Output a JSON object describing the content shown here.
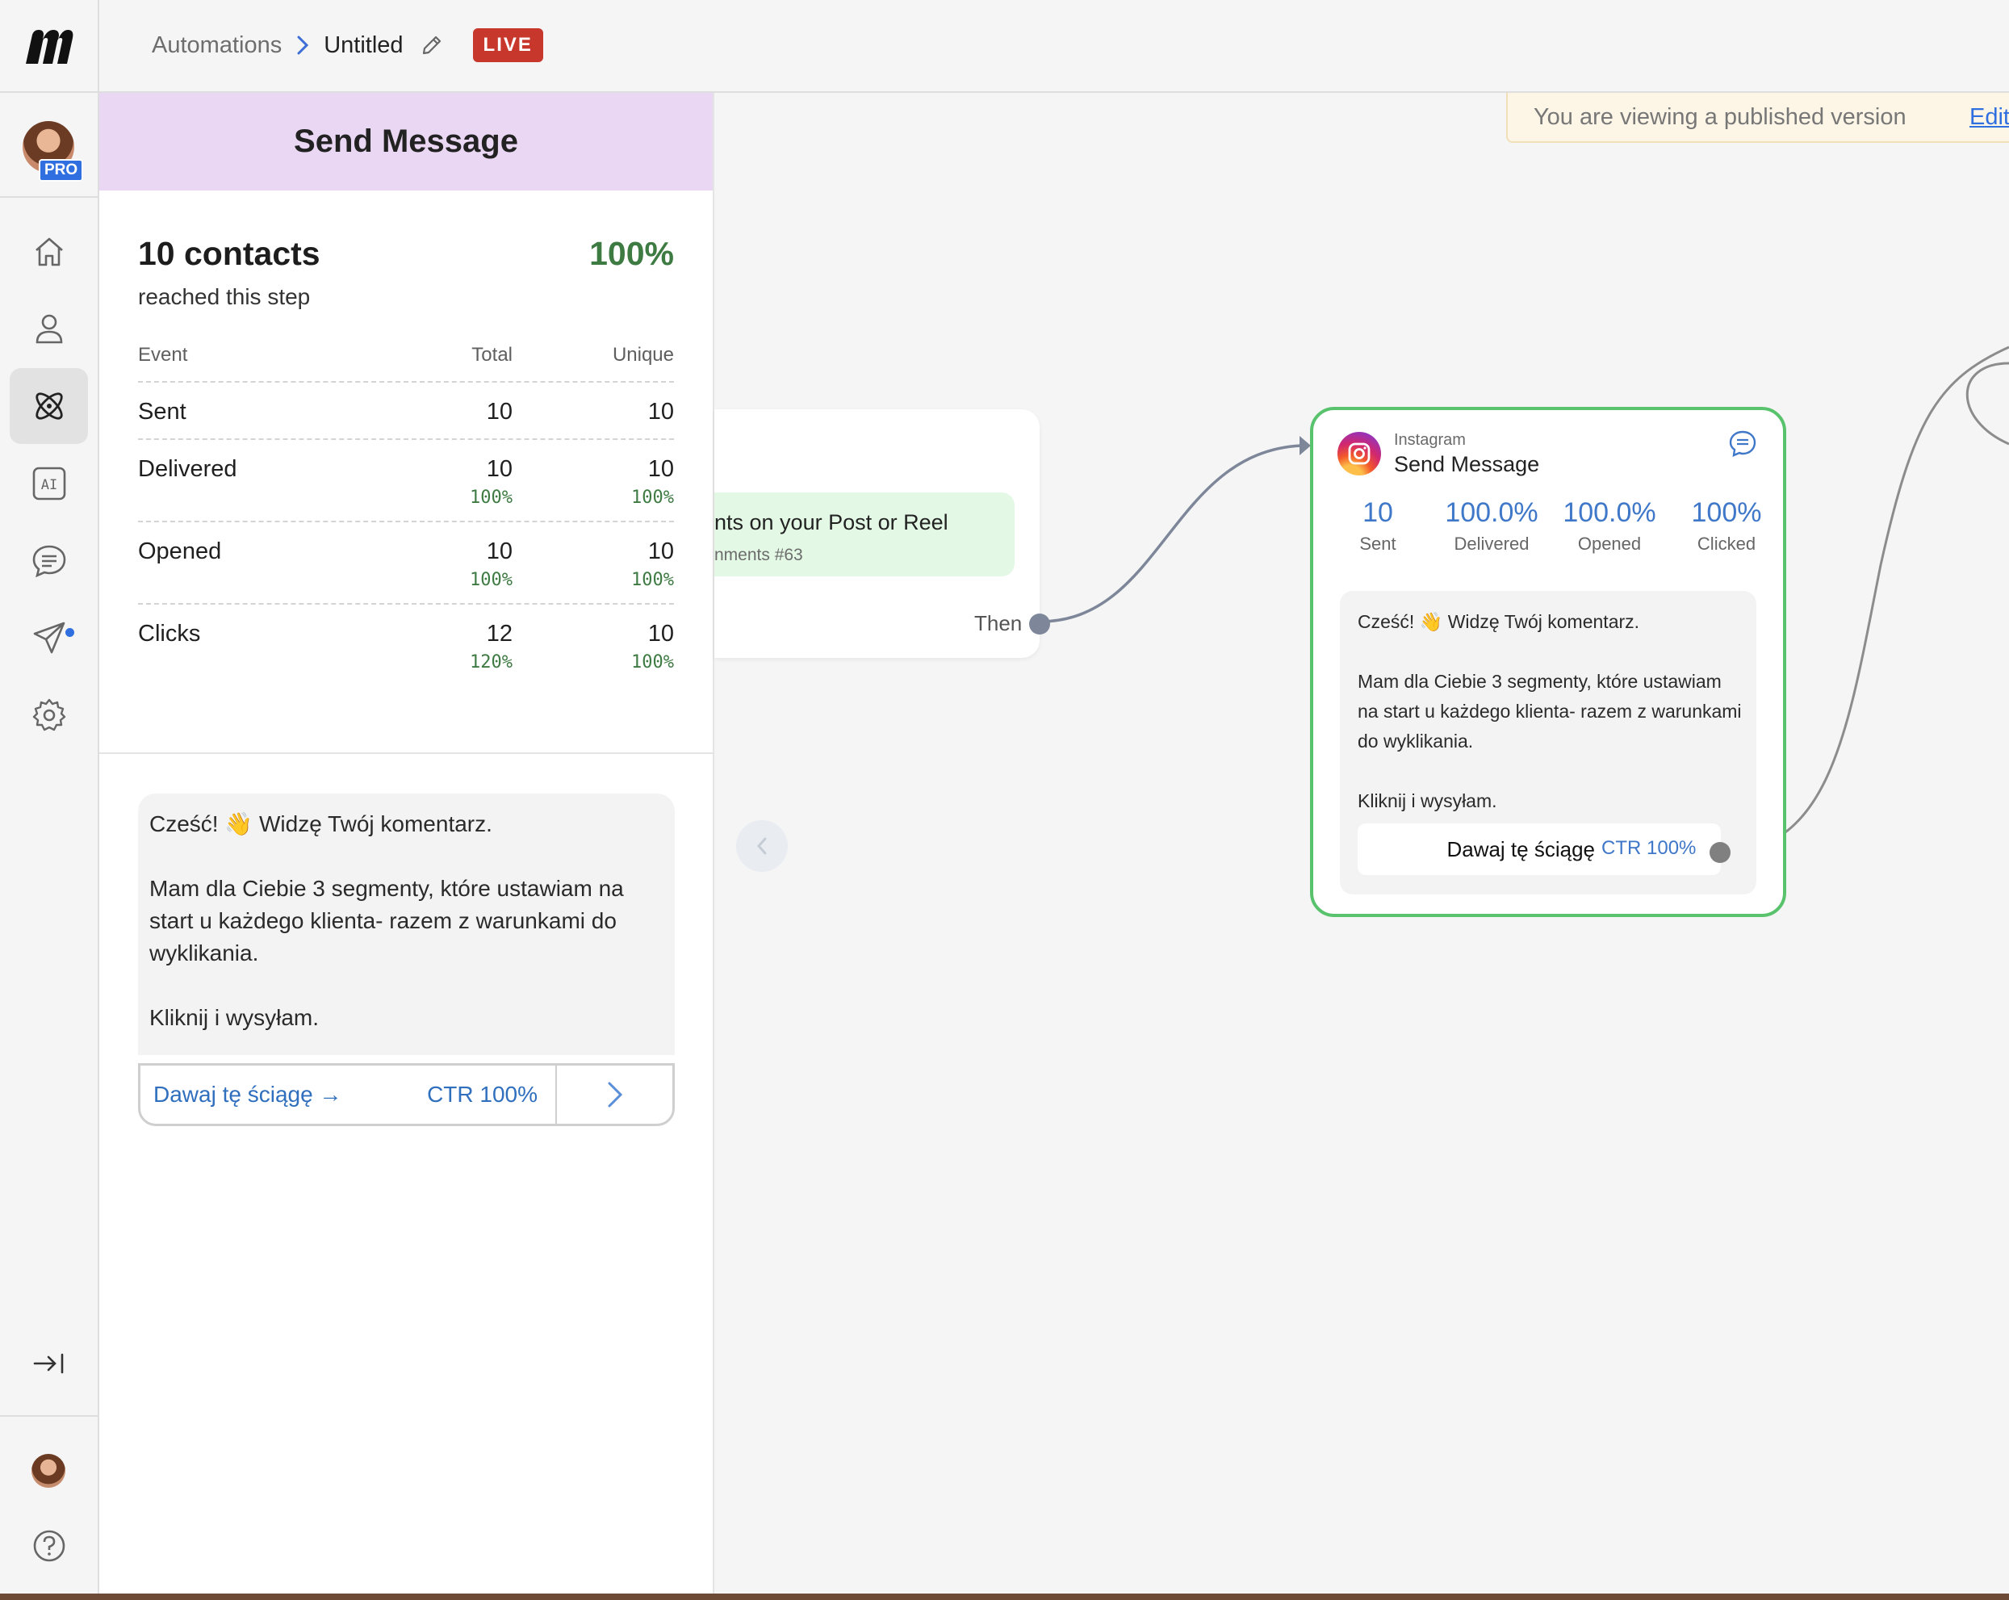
{
  "header": {
    "breadcrumb_root": "Automations",
    "breadcrumb_current": "Untitled",
    "status_badge": "LIVE"
  },
  "nav": {
    "pro_badge": "PRO",
    "items": [
      "home-icon",
      "user-icon",
      "automation-icon",
      "ai-icon",
      "chat-icon",
      "send-icon",
      "gear-icon"
    ],
    "active_item": "automation-icon",
    "chat_has_notification": true,
    "bottom_items": [
      "collapse-sidebar-icon",
      "account-avatar",
      "help-icon"
    ]
  },
  "panel": {
    "title": "Send Message",
    "contacts": "10 contacts",
    "reached_pct": "100%",
    "reached_label": "reached this step",
    "table_headers": [
      "Event",
      "Total",
      "Unique"
    ],
    "rows": [
      {
        "event": "Sent",
        "total": "10",
        "total_pct": "",
        "unique": "10",
        "unique_pct": ""
      },
      {
        "event": "Delivered",
        "total": "10",
        "total_pct": "100%",
        "unique": "10",
        "unique_pct": "100%"
      },
      {
        "event": "Opened",
        "total": "10",
        "total_pct": "100%",
        "unique": "10",
        "unique_pct": "100%"
      },
      {
        "event": "Clicks",
        "total": "12",
        "total_pct": "120%",
        "unique": "10",
        "unique_pct": "100%"
      }
    ],
    "message_text": "Cześć! 👋 Widzę Twój komentarz.\n\nMam dla Ciebie 3 segmenty, które ustawiam na start u każdego klienta- razem z warunkami do wyklikania.\n\nKliknij i wysyłam.",
    "button_label": "Dawaj tę ściągę →",
    "button_ctr": "CTR 100%"
  },
  "canvas": {
    "banner_text": "You are viewing a published version",
    "banner_edit": "Edit",
    "trigger": {
      "title": "nts on your Post or Reel",
      "subtitle": "nments #63",
      "then_label": "Then"
    },
    "instagram_node": {
      "platform": "Instagram",
      "title": "Send Message",
      "stats": [
        {
          "value": "10",
          "label": "Sent"
        },
        {
          "value": "100.0%",
          "label": "Delivered"
        },
        {
          "value": "100.0%",
          "label": "Opened"
        },
        {
          "value": "100%",
          "label": "Clicked"
        }
      ],
      "message_text": "Cześć! 👋 Widzę Twój komentarz.\n\nMam dla Ciebie 3 segmenty, które ustawiam na start u każdego klienta- razem z warunkami do wyklikania.\n\nKliknij i wysyłam.",
      "button_label": "Dawaj tę ściągę",
      "button_ctr": "CTR 100%"
    }
  },
  "colors": {
    "live": "#c7372b",
    "accent_blue": "#2f6fe0",
    "success_green": "#3e7b43",
    "node_border": "#59c26c",
    "panel_header": "#ead7f3"
  }
}
